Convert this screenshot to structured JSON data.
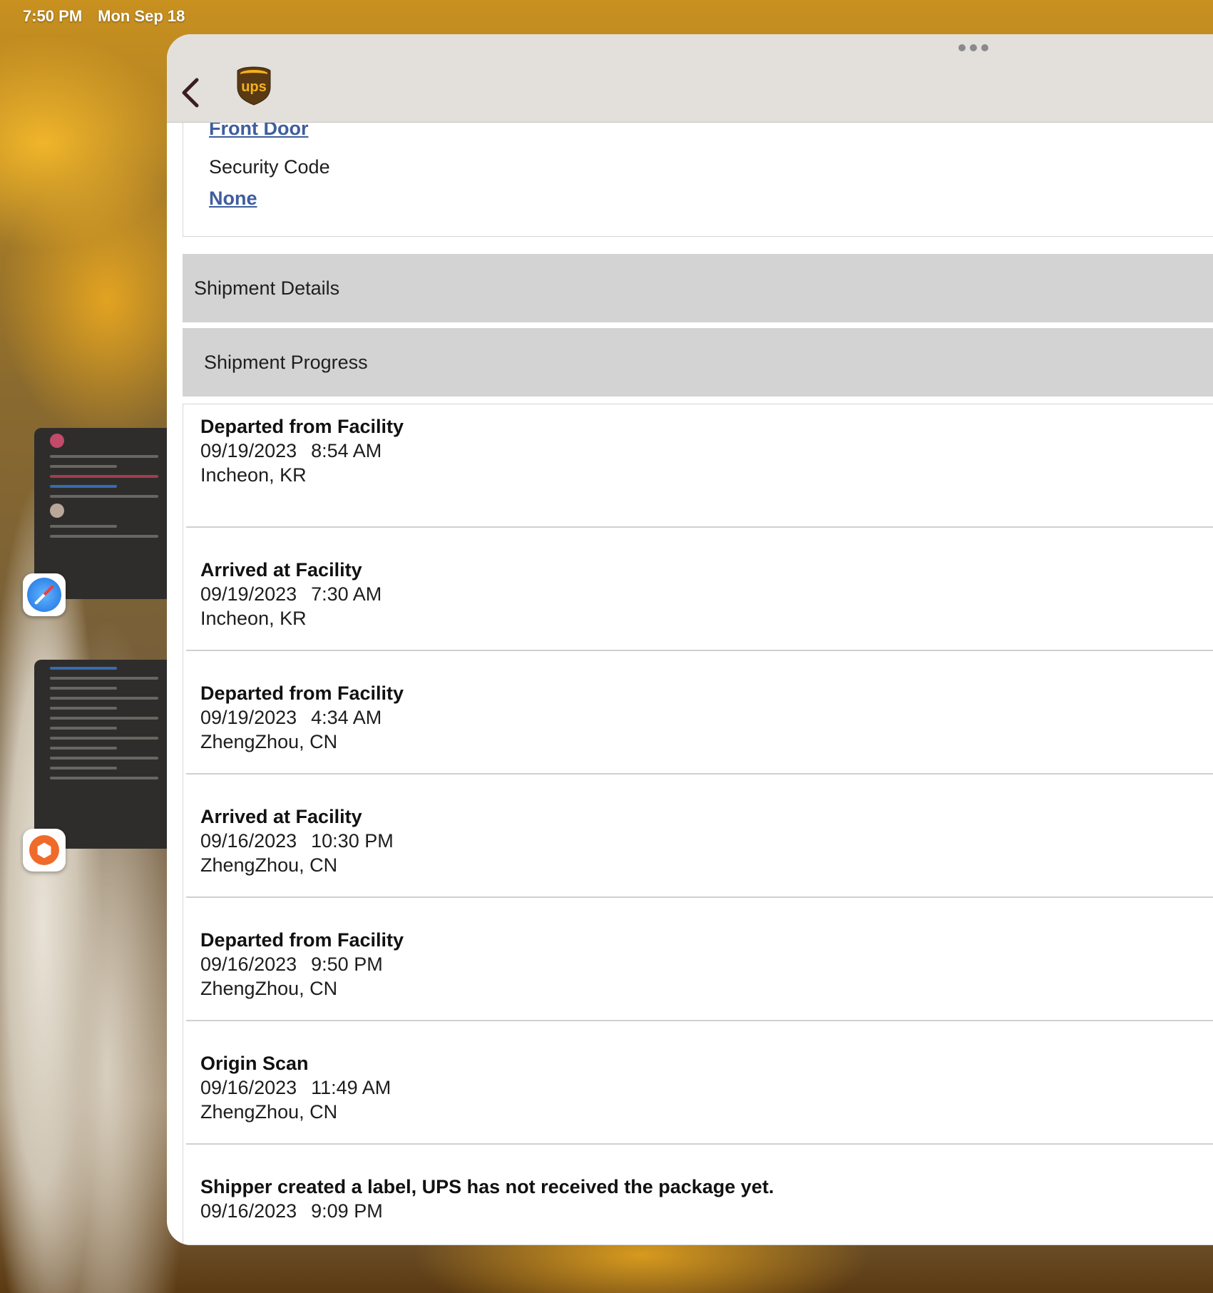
{
  "status_bar": {
    "time": "7:50 PM",
    "date": "Mon Sep 18"
  },
  "nav": {
    "logo_text": "ups"
  },
  "delivery": {
    "front_door_label": "Front Door",
    "security_code_label": "Security Code",
    "security_code_value": "None"
  },
  "sections": {
    "shipment_details": "Shipment Details",
    "shipment_progress": "Shipment Progress"
  },
  "progress": [
    {
      "status": "Departed from Facility",
      "date": "09/19/2023",
      "time": "8:54 AM",
      "location": "Incheon, KR"
    },
    {
      "status": "Arrived at Facility",
      "date": "09/19/2023",
      "time": "7:30 AM",
      "location": "Incheon, KR"
    },
    {
      "status": "Departed from Facility",
      "date": "09/19/2023",
      "time": "4:34 AM",
      "location": "ZhengZhou, CN"
    },
    {
      "status": "Arrived at Facility",
      "date": "09/16/2023",
      "time": "10:30 PM",
      "location": "ZhengZhou, CN"
    },
    {
      "status": "Departed from Facility",
      "date": "09/16/2023",
      "time": "9:50 PM",
      "location": "ZhengZhou, CN"
    },
    {
      "status": "Origin Scan",
      "date": "09/16/2023",
      "time": "11:49 AM",
      "location": "ZhengZhou, CN"
    },
    {
      "status": "Shipper created a label, UPS has not received the package yet.",
      "date": "09/16/2023",
      "time": "9:09 PM",
      "location": ""
    }
  ],
  "colors": {
    "link": "#3e5e9e",
    "ups_brown": "#5a3a12",
    "ups_gold": "#f5b21e"
  },
  "icons": {
    "back": "chevron-left-icon",
    "more": "more-dots-icon",
    "safari": "safari-icon",
    "cube_app": "cube-app-icon"
  }
}
